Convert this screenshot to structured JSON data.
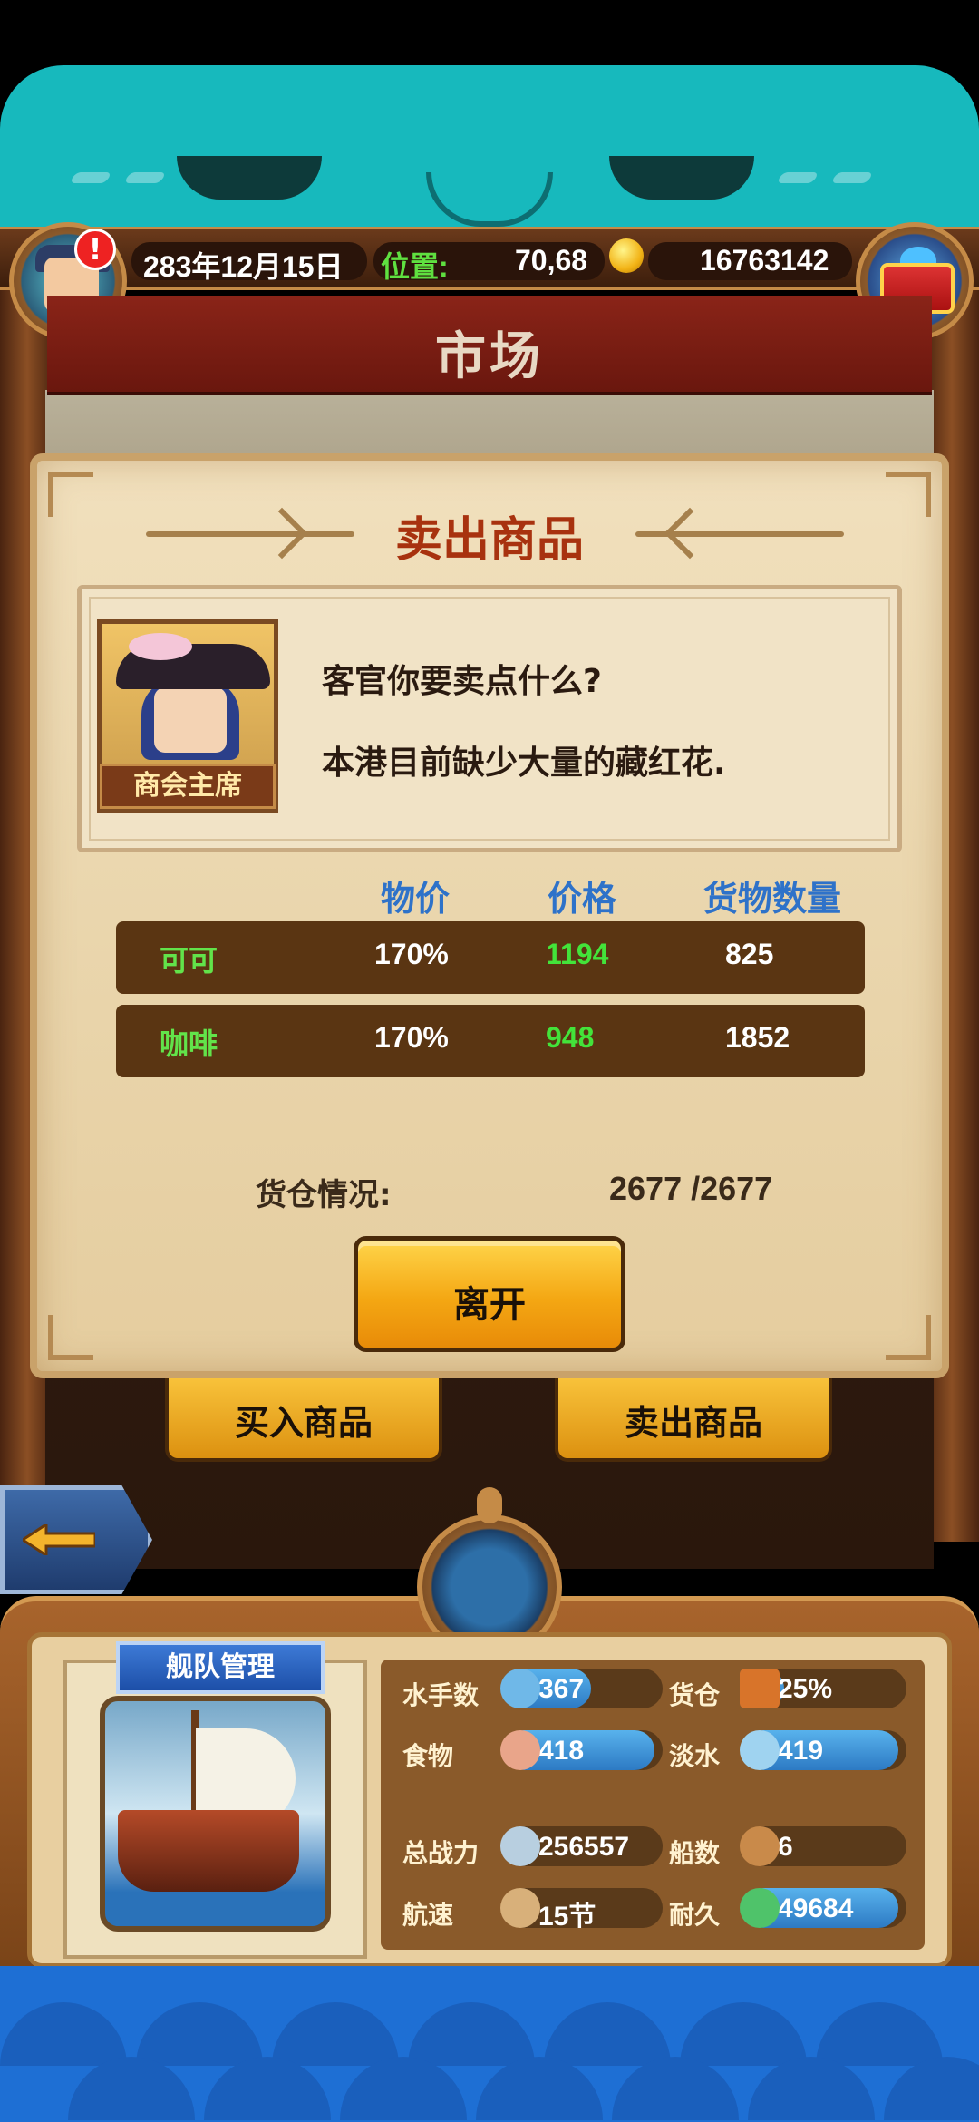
{
  "status_bar": {
    "date": "283年12月15日",
    "position_label": "位置:",
    "position_value": "70,68",
    "gold": "16763142",
    "alert_mark": "!"
  },
  "market": {
    "title": "市场"
  },
  "dialog": {
    "title": "卖出商品",
    "portrait_label": "商会主席",
    "message_line1": "客官你要卖点什么?",
    "message_line2": "本港目前缺少大量的藏红花.",
    "columns": {
      "rate": "物价",
      "price": "价格",
      "quantity": "货物数量"
    },
    "goods": [
      {
        "name": "可可",
        "rate": "170%",
        "price": "1194",
        "quantity": "825"
      },
      {
        "name": "咖啡",
        "rate": "170%",
        "price": "948",
        "quantity": "1852"
      }
    ],
    "hold_label": "货仓情况:",
    "hold_value": "2677 /2677",
    "leave_button": "离开"
  },
  "tabs": {
    "buy": "买入商品",
    "sell": "卖出商品"
  },
  "fleet": {
    "title": "舰队管理",
    "stats": {
      "sailors_label": "水手数",
      "sailors_value": "367",
      "sailors_fill": 0.55,
      "cargo_label": "货仓",
      "cargo_value": "25%",
      "cargo_fill": 0.25,
      "food_label": "食物",
      "food_value": "418",
      "food_fill": 0.95,
      "water_label": "淡水",
      "water_value": "419",
      "water_fill": 0.95,
      "power_label": "总战力",
      "power_value": "256557",
      "power_fill": 0.0,
      "ships_label": "船数",
      "ships_value": "6",
      "ships_fill": 0.0,
      "speed_label": "航速",
      "speed_value": "15节",
      "speed_fill": 0.0,
      "durability_label": "耐久",
      "durability_value": "49684",
      "durability_fill": 0.95
    }
  },
  "colors": {
    "accent_green": "#43e33a",
    "header_blue": "#2e72c9",
    "title_red": "#a8320f"
  }
}
